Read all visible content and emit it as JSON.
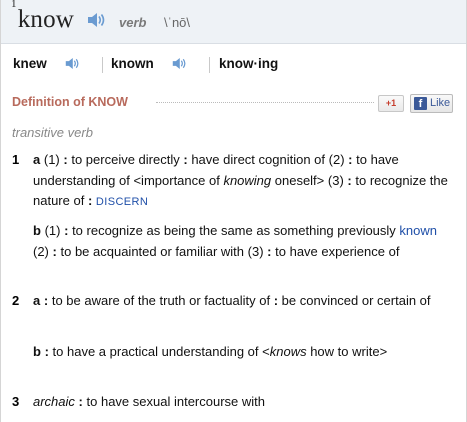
{
  "entry": {
    "homograph": "1",
    "headword": "know",
    "part_of_speech": "verb",
    "pronunciation": "\\ˈnō\\"
  },
  "inflections": [
    {
      "form": "knew"
    },
    {
      "form": "known"
    },
    {
      "form": "know·ing"
    }
  ],
  "definition_header": "Definition of KNOW",
  "share": {
    "gplus_label": "+1",
    "facebook_label": "Like"
  },
  "transitivity": "transitive verb",
  "senses": {
    "s1": {
      "number": "1",
      "a": {
        "letter": "a",
        "p1": "(1)",
        "t1": "to perceive directly",
        "t2": "have direct cognition of",
        "p2": "(2)",
        "t3": "to have understanding of <importance of ",
        "t3_em": "knowing",
        "t3_end": " oneself>",
        "p3": "(3)",
        "t4": "to recognize the nature of",
        "xref": "DISCERN"
      },
      "b": {
        "letter": "b",
        "p1": "(1)",
        "t1": "to recognize as being the same as something previously ",
        "link": "known",
        "p2": "(2)",
        "t2": "to be acquainted or familiar with",
        "p3": "(3)",
        "t3": "to have experience of"
      }
    },
    "s2": {
      "number": "2",
      "a": {
        "letter": "a",
        "t1": "to be aware of the truth or factuality of",
        "t2": "be convinced or certain of"
      },
      "b": {
        "letter": "b",
        "t1": "to have a practical understanding of <",
        "t1_em": "knows",
        "t1_end": " how to write>"
      }
    },
    "s3": {
      "number": "3",
      "label": "archaic",
      "t1": "to have sexual intercourse with"
    }
  },
  "colors": {
    "header_bg": "#eef2f6",
    "definition_header": "#b86a5c",
    "link": "#1f4fa8",
    "speaker_icon": "#6a9bd1"
  }
}
